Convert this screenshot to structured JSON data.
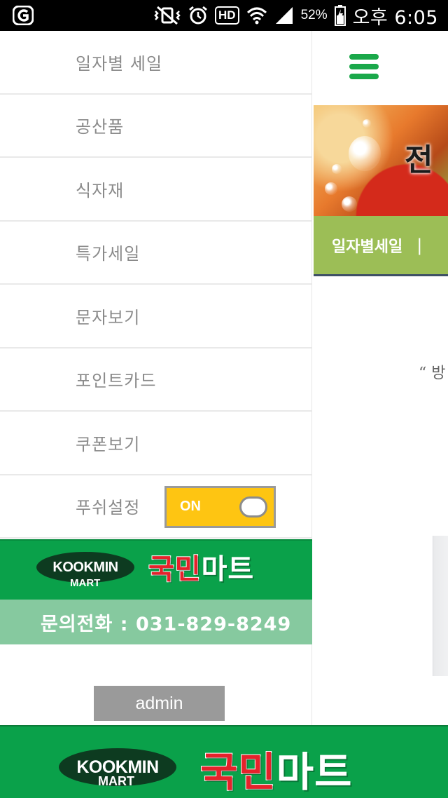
{
  "status_bar": {
    "battery": "52%",
    "time": "오후 6:05",
    "icons": [
      "app-notification-icon",
      "vibrate-mute-icon",
      "alarm-icon",
      "hd-icon",
      "wifi-icon",
      "signal-icon",
      "battery-icon"
    ],
    "hd_label": "HD"
  },
  "drawer": {
    "menu": [
      {
        "label": "일자별 세일"
      },
      {
        "label": "공산품"
      },
      {
        "label": "식자재"
      },
      {
        "label": "특가세일"
      },
      {
        "label": "문자보기"
      },
      {
        "label": "포인트카드"
      },
      {
        "label": "쿠폰보기"
      },
      {
        "label": "푸쉬설정"
      }
    ],
    "push_toggle": {
      "state": "ON",
      "on": true
    },
    "logo": {
      "brand": "KOOKMIN",
      "sub": "MART",
      "name_red": "국민",
      "name_white": "마트"
    },
    "phone": "문의전화 : 031-829-8249",
    "admin_button": "admin"
  },
  "page": {
    "banner_title": "전",
    "category_label": "일자별세일",
    "category_separator": "|",
    "quote": "“ 방"
  },
  "bottom_banner": {
    "brand": "KOOKMIN",
    "sub": "MART",
    "name_red": "국민",
    "name_white": "마트"
  },
  "colors": {
    "brand_green": "#0aa14a",
    "toggle_yellow": "#fec512",
    "category_bar": "#9cbe56",
    "phone_bar": "#86c99f",
    "logo_red": "#e5222b"
  }
}
